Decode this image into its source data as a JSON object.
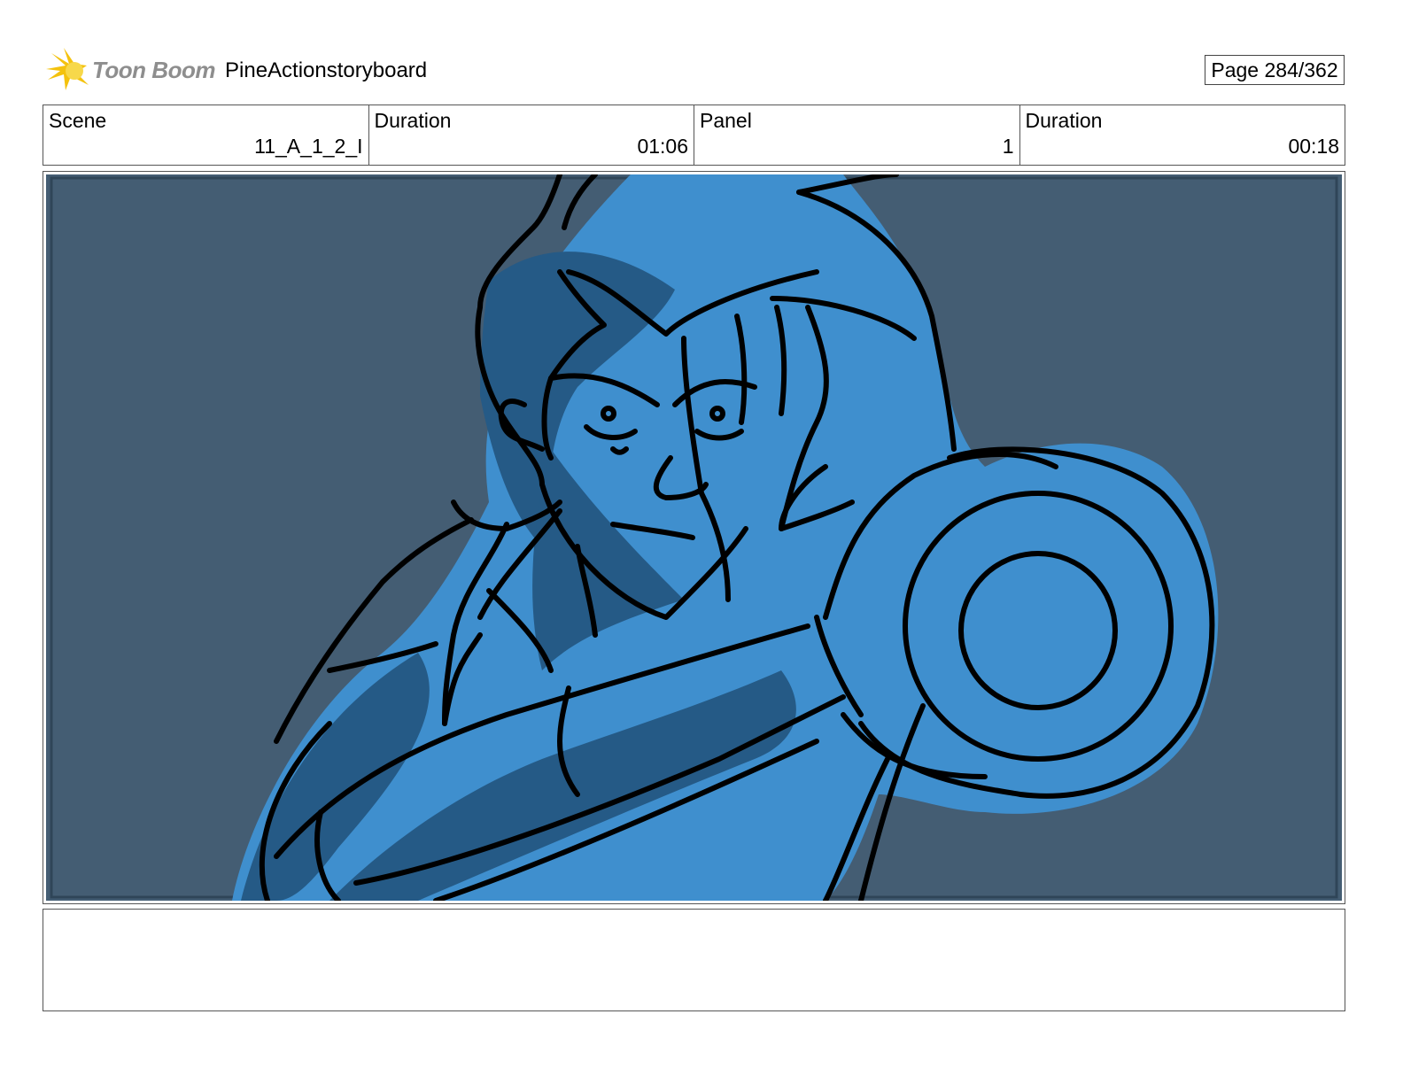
{
  "header": {
    "logo_text": "Toon Boom",
    "project_title": "PineActionstoryboard",
    "page_indicator": "Page 284/362"
  },
  "info": {
    "scene_label": "Scene",
    "scene_value": "11_A_1_2_I",
    "scene_duration_label": "Duration",
    "scene_duration_value": "01:06",
    "panel_label": "Panel",
    "panel_value": "1",
    "panel_duration_label": "Duration",
    "panel_duration_value": "00:18"
  },
  "panel": {
    "background_color": "#445d73",
    "fill_color": "#3f8fce",
    "shadow_color": "#255a86",
    "line_color": "#000000"
  },
  "notes": {
    "text": ""
  }
}
